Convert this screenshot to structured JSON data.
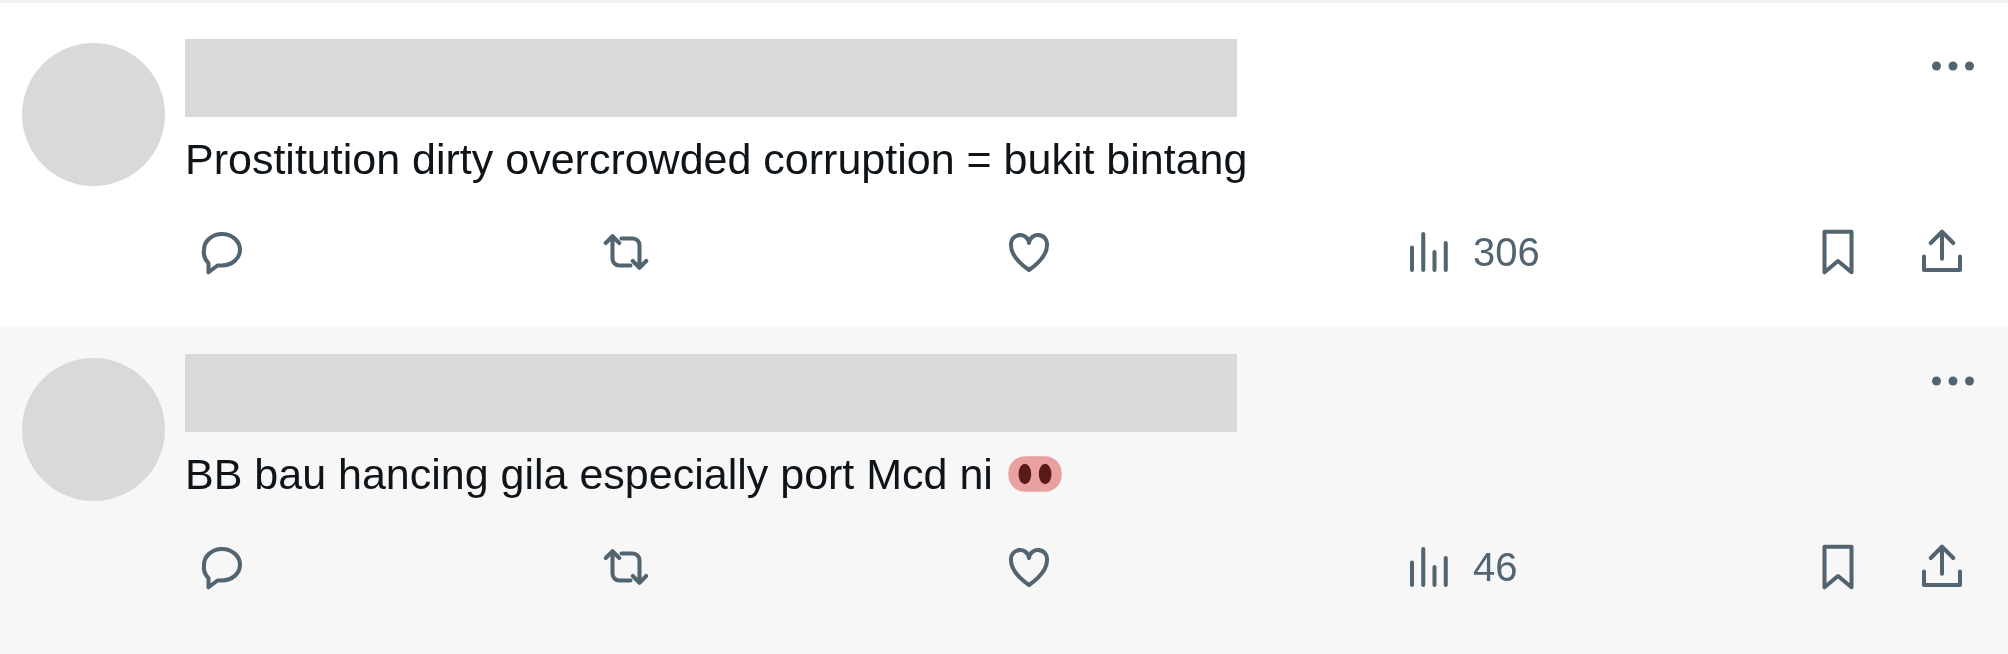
{
  "posts": [
    {
      "text": "Prostitution dirty overcrowded corruption = bukit bintang",
      "has_emoji": false,
      "highlighted": false,
      "views": "306"
    },
    {
      "text": "BB bau hancing gila especially port Mcd ni",
      "has_emoji": true,
      "highlighted": true,
      "views": "46"
    }
  ]
}
